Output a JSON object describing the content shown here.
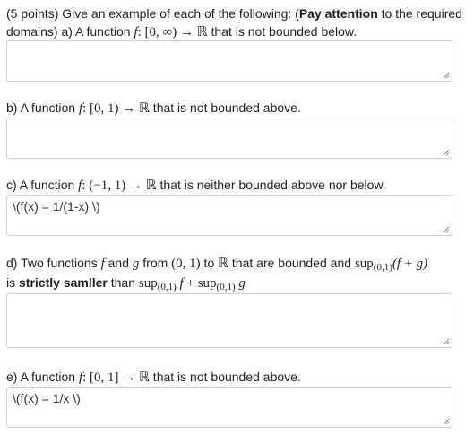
{
  "qa": {
    "points": "(5 points) Give an example of each of the following: (",
    "bold": "Pay attention",
    "rest1": " to the required domains) a) A function ",
    "f": "f",
    "map": ": [0, ∞) → ℝ",
    "tail": " that is not bounded below.",
    "answer": ""
  },
  "qb": {
    "pre": "b) A function ",
    "f": "f",
    "map": ": [0, 1) → ℝ",
    "tail": " that is not bounded above.",
    "answer": ""
  },
  "qc": {
    "pre": "c) A function ",
    "f": "f",
    "map": ": (−1, 1) → ℝ",
    "tail": " that is neither bounded above nor below.",
    "answer": "\\(f(x) = 1/(1-x) \\)"
  },
  "qd": {
    "pre": "d) Two functions ",
    "f": "f",
    "and": " and ",
    "g": "g",
    "from": " from ",
    "interval": "(0, 1)",
    "to": " to ",
    "R": "ℝ",
    "mid": " that are bounded and ",
    "sup": "sup",
    "sub01": "(0,1)",
    "expr": "(f + g)",
    "is": "is ",
    "strict": "strictly samller",
    "than": " than ",
    "sup2": "sup",
    "sub02": "(0,1)",
    "f2": " f",
    "plus": " + ",
    "sup3": "sup",
    "sub03": "(0,1)",
    "g2": " g",
    "answer": ""
  },
  "qe": {
    "pre": "e) A function ",
    "f": "f",
    "map": ": [0, 1] → ℝ",
    "tail": " that is not bounded above.",
    "answer": "\\(f(x) = 1/x \\)"
  }
}
